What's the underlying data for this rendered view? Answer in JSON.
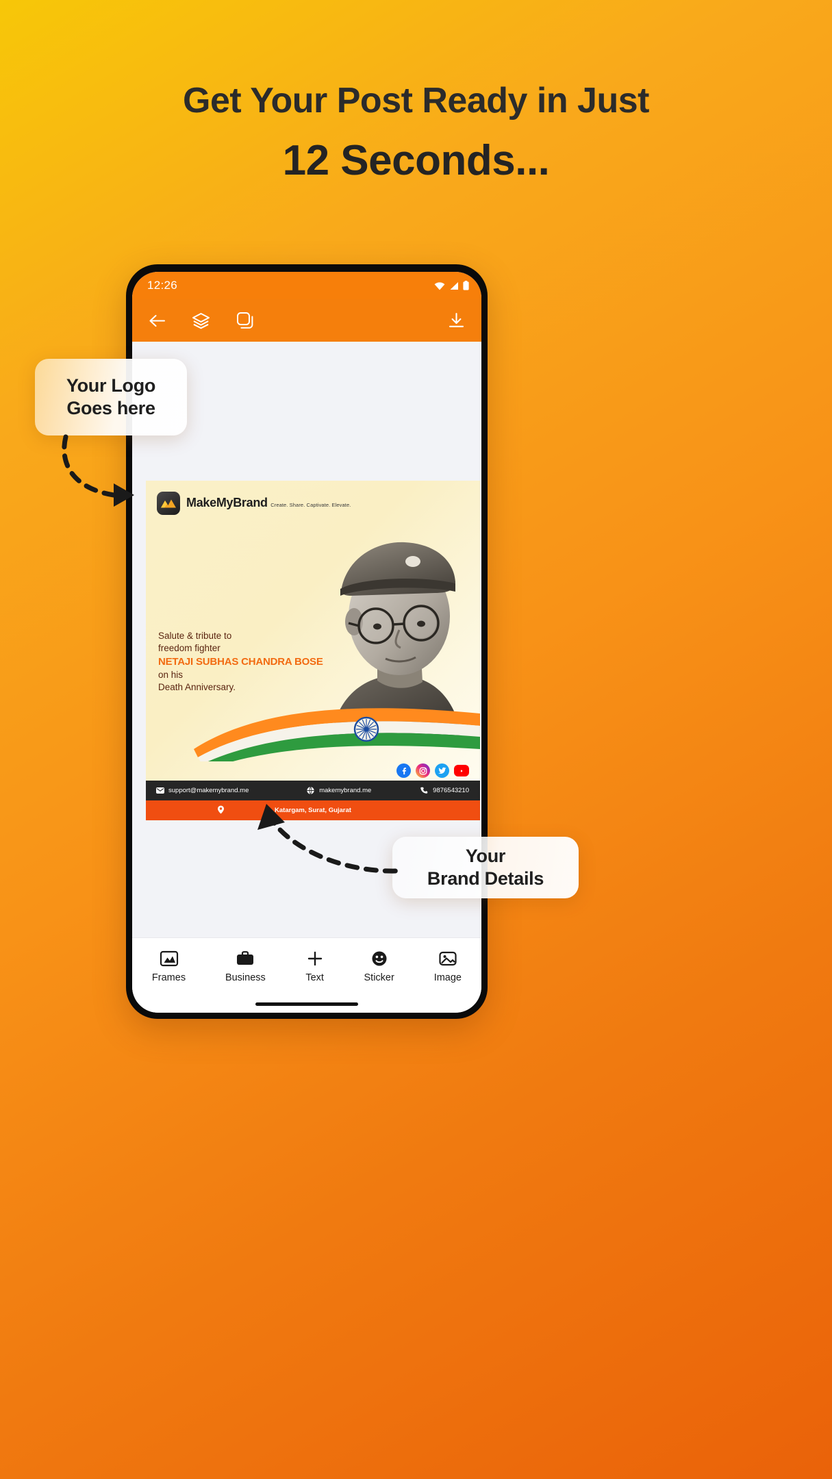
{
  "headline": {
    "line1": "Get Your Post Ready in Just",
    "line2": "12 Seconds..."
  },
  "phone": {
    "status_bar": {
      "time": "12:26",
      "icons": [
        "wifi-icon",
        "signal-icon",
        "battery-icon"
      ]
    },
    "app_bar": {
      "back_label": "back-arrow-icon",
      "layers_label": "layers-icon",
      "duplicate_label": "duplicate-icon",
      "download_label": "download-icon"
    },
    "bottom_nav": [
      {
        "label": "Frames",
        "icon": "frames-icon"
      },
      {
        "label": "Business",
        "icon": "briefcase-icon"
      },
      {
        "label": "Text",
        "icon": "plus-icon"
      },
      {
        "label": "Sticker",
        "icon": "smiley-icon"
      },
      {
        "label": "Image",
        "icon": "image-icon"
      }
    ]
  },
  "poster": {
    "brand": {
      "name": "MakeMyBrand",
      "tagline": "Create. Share. Captivate. Elevate."
    },
    "tribute": {
      "line1": "Salute & tribute to",
      "line2": "freedom fighter",
      "person": "NETAJI SUBHAS CHANDRA BOSE",
      "line3": "on his",
      "line4": "Death Anniversary."
    },
    "socials": [
      "facebook-icon",
      "instagram-icon",
      "twitter-icon",
      "youtube-icon"
    ],
    "contact": {
      "email": "support@makemybrand.me",
      "website": "makemybrand.me",
      "phone": "9876543210",
      "address": "Katargam, Surat, Gujarat"
    }
  },
  "callouts": {
    "logo": {
      "line1": "Your Logo",
      "line2": "Goes here"
    },
    "brand": {
      "line1": "Your",
      "line2": "Brand Details"
    }
  },
  "colors": {
    "bg_start": "#F7C708",
    "bg_end": "#EA6209",
    "appbar": "#F57F0C",
    "statusbar": "#F77F0A",
    "accent_orange": "#F26B12",
    "address_bar": "#F04E11",
    "contact_bar": "#262626",
    "poster_bg": "#FAF0C8"
  }
}
